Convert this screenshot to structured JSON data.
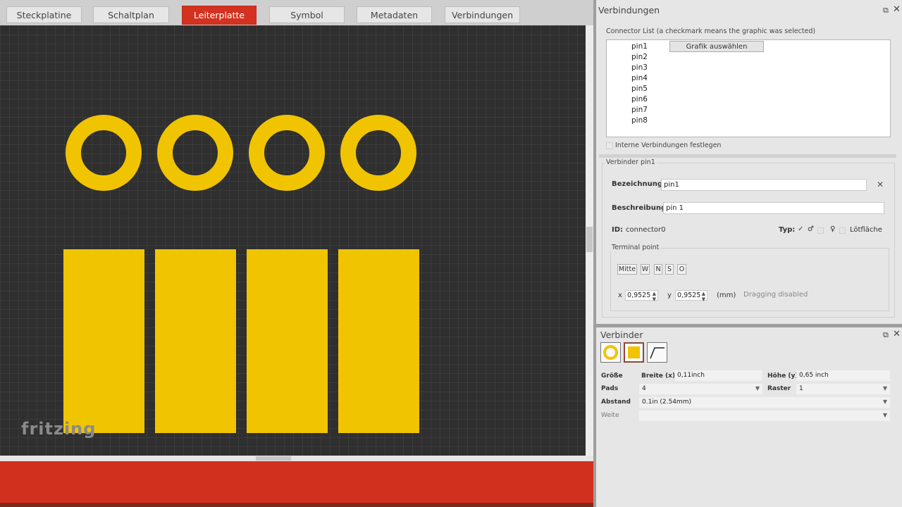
{
  "tabs": [
    "Steckplatine",
    "Schaltplan",
    "Leiterplatte",
    "Symbol",
    "Metadaten",
    "Verbindungen"
  ],
  "active_tab": "Leiterplatte",
  "logo": "fritzing",
  "connections_panel": {
    "title": "Verbindungen",
    "list_caption": "Connector List (a checkmark means the graphic was selected)",
    "pins": [
      "pin1",
      "pin2",
      "pin3",
      "pin4",
      "pin5",
      "pin6",
      "pin7",
      "pin8"
    ],
    "select_graphic_button": "Grafik auswählen",
    "internal_connections": "Interne Verbindungen festlegen",
    "connector_group": "Verbinder pin1",
    "name_label": "Bezeichnung:",
    "name_value": "pin1",
    "description_label": "Beschreibung:",
    "description_value": "pin 1",
    "id_label": "ID:",
    "id_value": "connector0",
    "type_label": "Typ:",
    "type_option_male": "♂",
    "type_option_female": "♀",
    "type_option_pad": "Lötfläche",
    "terminal_group": "Terminal point",
    "terminal_buttons": [
      "Mitte",
      "W",
      "N",
      "S",
      "O"
    ],
    "x_label": "x",
    "x_value": "0,9525",
    "y_label": "y",
    "y_value": "0,9525",
    "unit": "(mm)",
    "drag_note": "Dragging disabled"
  },
  "verbinder_panel": {
    "title": "Verbinder",
    "size_label": "Größe",
    "width_label": "Breite (x)",
    "width_value": "0,11inch",
    "height_label": "Höhe (y)",
    "height_value": "0,65 inch",
    "pads_label": "Pads",
    "pads_value": "4",
    "raster_label": "Raster",
    "raster_value": "1",
    "spacing_label": "Abstand",
    "spacing_value": "0.1in (2.54mm)",
    "weite_label": "Weite",
    "weite_value": ""
  },
  "colors": {
    "accent": "#d33220",
    "copper": "#f0c400",
    "canvas": "#2f2f2f"
  }
}
